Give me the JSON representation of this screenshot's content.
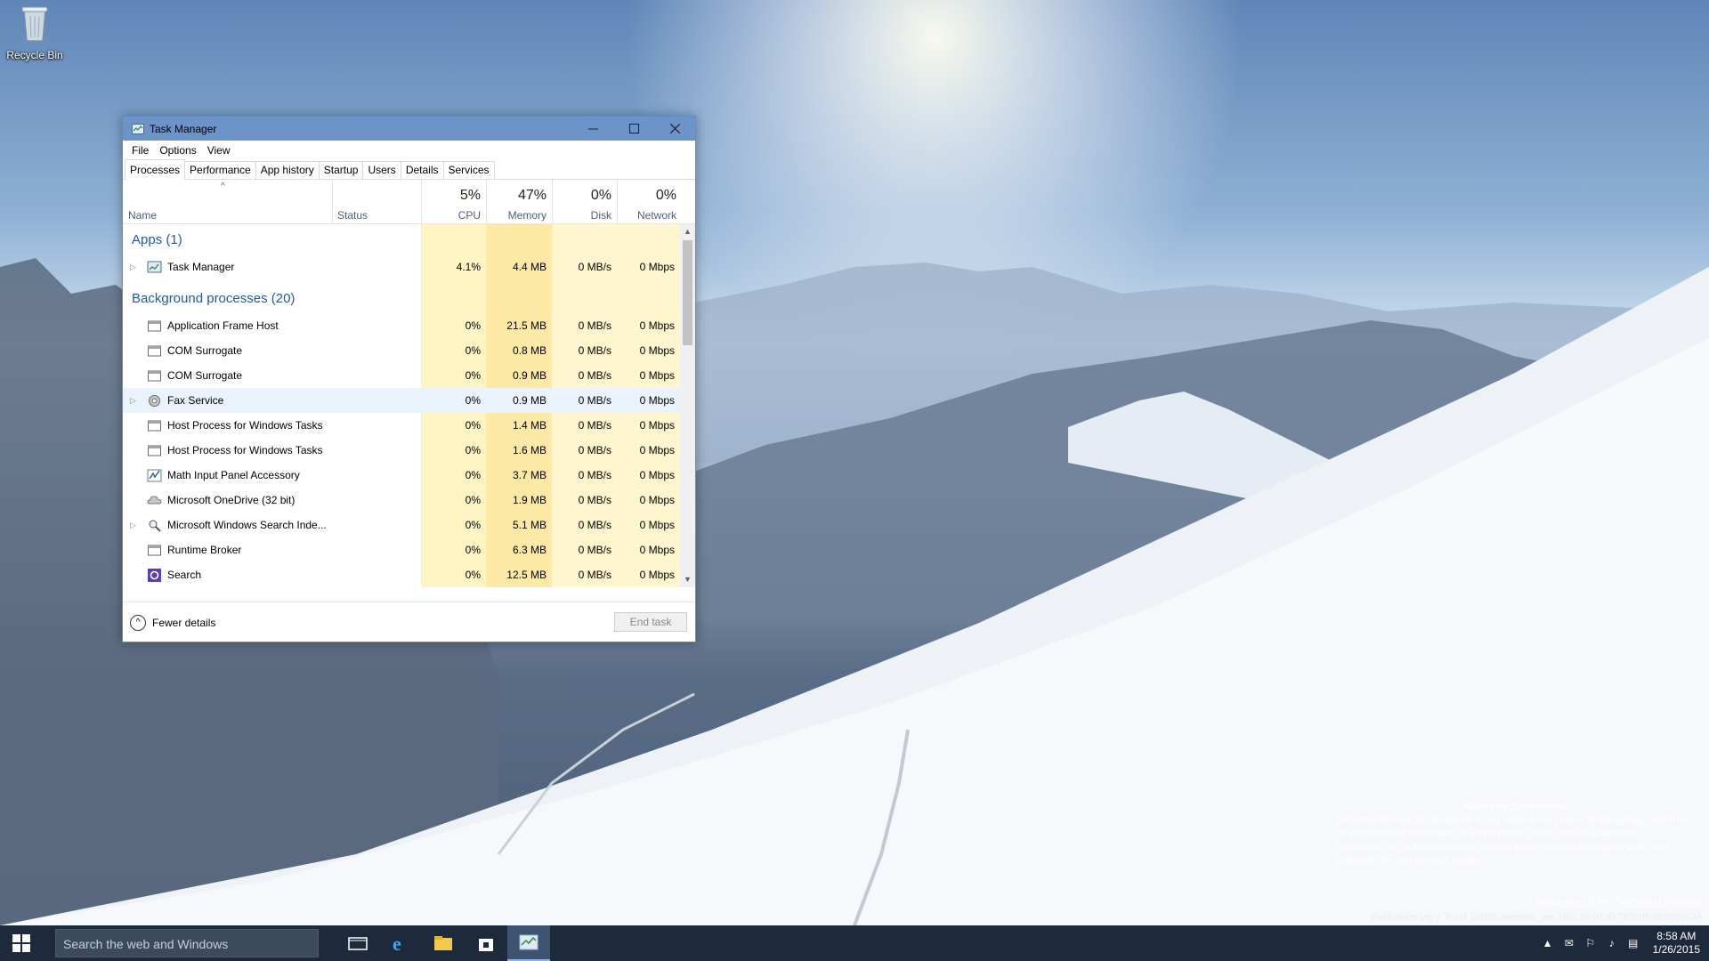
{
  "desktop": {
    "recycle_bin_label": "Recycle Bin",
    "watermark": {
      "title": "Microsoft Confidential",
      "body": "Unauthorized use or disclosure in any manner may result in disciplinary action up to and including termination of employment (in the case of employees), termination of an assignment or contract (in the case of contingent staff), and potential civil and criminal liability."
    },
    "build": {
      "edition": "Windows 10 Pro Technical Preview",
      "build_line": "Evaluation copy. Build 10005.winmain_prs.150125-0130.783dd528d056f424"
    }
  },
  "window": {
    "title": "Task Manager",
    "menu": [
      "File",
      "Options",
      "View"
    ],
    "tabs": [
      "Processes",
      "Performance",
      "App history",
      "Startup",
      "Users",
      "Details",
      "Services"
    ],
    "active_tab": "Processes",
    "columns": {
      "name": "Name",
      "status": "Status",
      "cpu": {
        "pct": "5%",
        "label": "CPU"
      },
      "memory": {
        "pct": "47%",
        "label": "Memory"
      },
      "disk": {
        "pct": "0%",
        "label": "Disk"
      },
      "network": {
        "pct": "0%",
        "label": "Network"
      }
    },
    "groups": {
      "apps": "Apps (1)",
      "background": "Background processes (20)"
    },
    "apps": [
      {
        "name": "Task Manager",
        "cpu": "4.1%",
        "memory": "4.4 MB",
        "disk": "0 MB/s",
        "network": "0 Mbps",
        "expandable": true,
        "icon": "task-manager-icon"
      }
    ],
    "background": [
      {
        "name": "Application Frame Host",
        "cpu": "0%",
        "memory": "21.5 MB",
        "disk": "0 MB/s",
        "network": "0 Mbps",
        "expandable": false,
        "icon": "app-window-icon"
      },
      {
        "name": "COM Surrogate",
        "cpu": "0%",
        "memory": "0.8 MB",
        "disk": "0 MB/s",
        "network": "0 Mbps",
        "expandable": false,
        "icon": "app-window-icon"
      },
      {
        "name": "COM Surrogate",
        "cpu": "0%",
        "memory": "0.9 MB",
        "disk": "0 MB/s",
        "network": "0 Mbps",
        "expandable": false,
        "icon": "app-window-icon"
      },
      {
        "name": "Fax Service",
        "cpu": "0%",
        "memory": "0.9 MB",
        "disk": "0 MB/s",
        "network": "0 Mbps",
        "expandable": true,
        "icon": "service-gear-icon"
      },
      {
        "name": "Host Process for Windows Tasks",
        "cpu": "0%",
        "memory": "1.4 MB",
        "disk": "0 MB/s",
        "network": "0 Mbps",
        "expandable": false,
        "icon": "app-window-icon"
      },
      {
        "name": "Host Process for Windows Tasks",
        "cpu": "0%",
        "memory": "1.6 MB",
        "disk": "0 MB/s",
        "network": "0 Mbps",
        "expandable": false,
        "icon": "app-window-icon"
      },
      {
        "name": "Math Input Panel Accessory",
        "cpu": "0%",
        "memory": "3.7 MB",
        "disk": "0 MB/s",
        "network": "0 Mbps",
        "expandable": false,
        "icon": "math-input-icon"
      },
      {
        "name": "Microsoft OneDrive (32 bit)",
        "cpu": "0%",
        "memory": "1.9 MB",
        "disk": "0 MB/s",
        "network": "0 Mbps",
        "expandable": false,
        "icon": "cloud-icon"
      },
      {
        "name": "Microsoft Windows Search Inde...",
        "cpu": "0%",
        "memory": "5.1 MB",
        "disk": "0 MB/s",
        "network": "0 Mbps",
        "expandable": true,
        "icon": "search-indexer-icon"
      },
      {
        "name": "Runtime Broker",
        "cpu": "0%",
        "memory": "6.3 MB",
        "disk": "0 MB/s",
        "network": "0 Mbps",
        "expandable": false,
        "icon": "app-window-icon"
      },
      {
        "name": "Search",
        "cpu": "0%",
        "memory": "12.5 MB",
        "disk": "0 MB/s",
        "network": "0 Mbps",
        "expandable": false,
        "icon": "search-circle-icon"
      }
    ],
    "selected_row": "Fax Service",
    "footer": {
      "fewer_details": "Fewer details",
      "end_task": "End task"
    }
  },
  "taskbar": {
    "search_placeholder": "Search the web and Windows",
    "apps": [
      "task-view-icon",
      "internet-explorer-icon",
      "file-explorer-icon",
      "store-icon",
      "task-manager-icon"
    ],
    "active_app": "task-manager-icon",
    "time": "8:58 AM",
    "date": "1/26/2015"
  },
  "colors": {
    "heat_cpu": "#fff4c4",
    "heat_memory": "#fde9a6",
    "heat_light": "#fff6d0",
    "title_bar": "#6d94c8",
    "group_text": "#1e5aa8",
    "taskbar": "#1d2a3b"
  }
}
